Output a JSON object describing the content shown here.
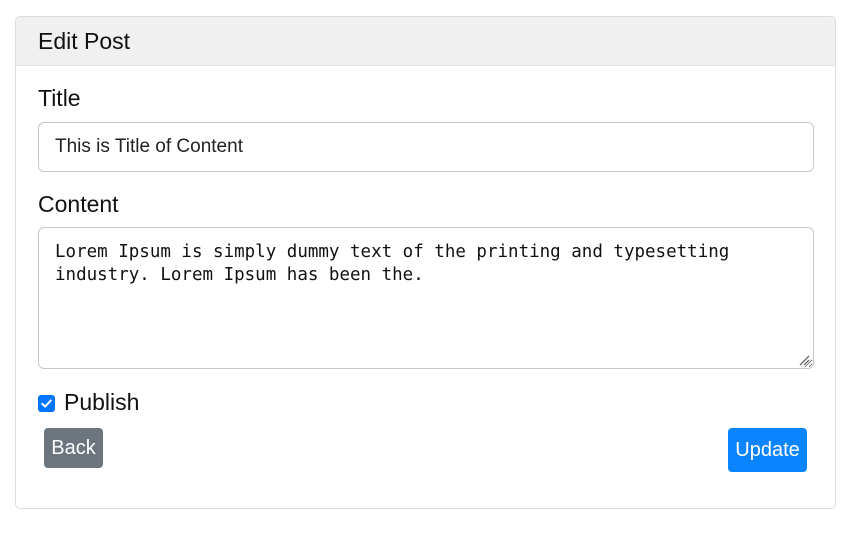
{
  "card": {
    "header": "Edit Post"
  },
  "form": {
    "title_label": "Title",
    "title_value": "This is Title of Content",
    "content_label": "Content",
    "content_value": "Lorem Ipsum is simply dummy text of the printing and typesetting industry. Lorem Ipsum has been the.",
    "publish_label": "Publish",
    "publish_checked": true
  },
  "buttons": {
    "back_label": "Back",
    "update_label": "Update"
  },
  "colors": {
    "header_bg": "#f0f0f0",
    "back_button": "#6c757d",
    "update_button": "#0a84ff",
    "checkbox": "#0075ff"
  },
  "icons": {
    "checkbox": "check-icon",
    "textarea_resize": "resize-grip-icon"
  }
}
